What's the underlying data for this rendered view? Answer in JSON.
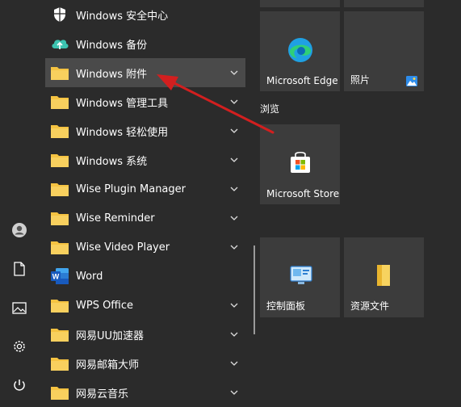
{
  "apps": [
    {
      "label": "Windows 安全中心",
      "icon": "shield-icon",
      "chevron": false
    },
    {
      "label": "Windows 备份",
      "icon": "cloud-backup-icon",
      "chevron": false
    },
    {
      "label": "Windows 附件",
      "icon": "folder-icon",
      "chevron": true,
      "highlighted": true
    },
    {
      "label": "Windows 管理工具",
      "icon": "folder-icon",
      "chevron": true
    },
    {
      "label": "Windows 轻松使用",
      "icon": "folder-icon",
      "chevron": true
    },
    {
      "label": "Windows 系统",
      "icon": "folder-icon",
      "chevron": true
    },
    {
      "label": "Wise Plugin Manager",
      "icon": "folder-icon",
      "chevron": true
    },
    {
      "label": "Wise Reminder",
      "icon": "folder-icon",
      "chevron": true
    },
    {
      "label": "Wise Video Player",
      "icon": "folder-icon",
      "chevron": true
    },
    {
      "label": "Word",
      "icon": "word-icon",
      "chevron": false
    },
    {
      "label": "WPS Office",
      "icon": "folder-icon",
      "chevron": true
    },
    {
      "label": "网易UU加速器",
      "icon": "folder-icon",
      "chevron": true
    },
    {
      "label": "网易邮箱大师",
      "icon": "folder-icon",
      "chevron": true
    },
    {
      "label": "网易云音乐",
      "icon": "folder-icon",
      "chevron": true
    }
  ],
  "rail": [
    "user-icon",
    "document-icon",
    "pictures-icon",
    "settings-icon",
    "power-icon"
  ],
  "tiles": {
    "edge": "Microsoft Edge",
    "photos": "照片",
    "group_browse": "浏览",
    "store": "Microsoft Store",
    "control_panel": "控制面板",
    "explorer": "资源文件"
  },
  "colors": {
    "background": "#2b2b2b",
    "tile": "#3c3c3c",
    "highlight": "#4a4a4a",
    "folder": "#f5c342",
    "arrow": "#d21f1f"
  }
}
